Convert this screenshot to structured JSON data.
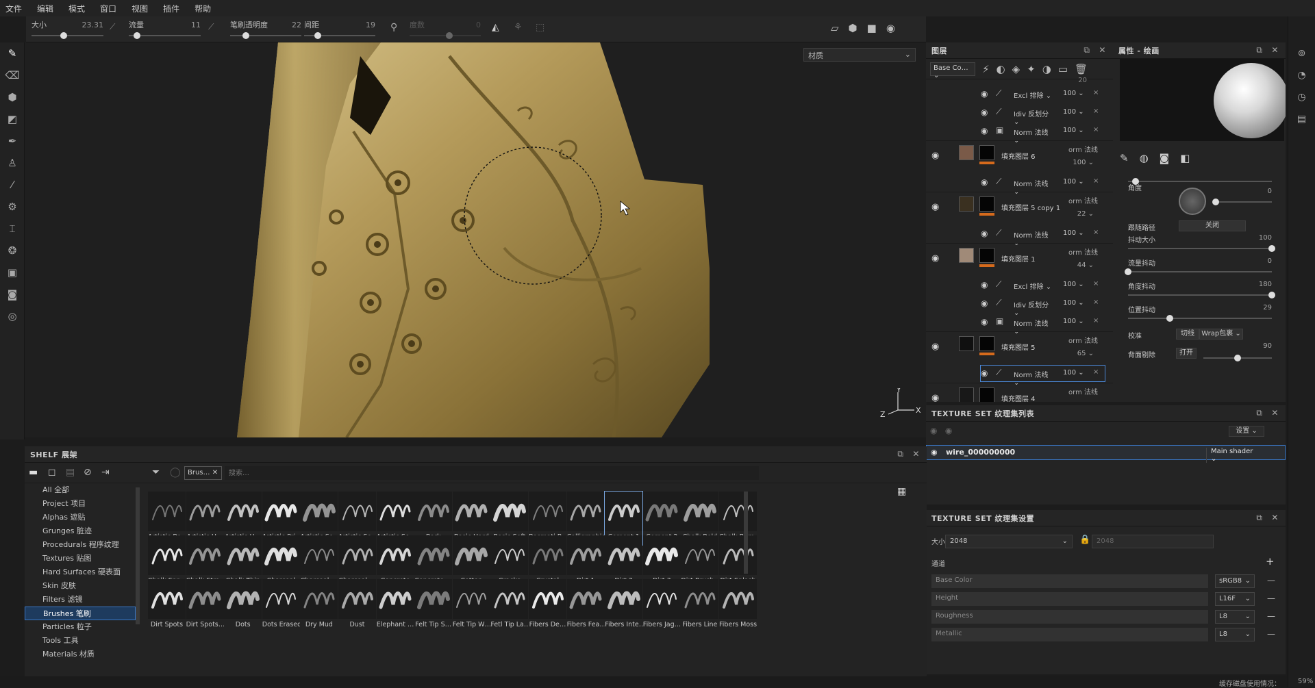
{
  "menu": [
    "文件",
    "编辑",
    "模式",
    "窗口",
    "视图",
    "插件",
    "帮助"
  ],
  "toolbar": {
    "size_label": "大小",
    "size_value": "23.31",
    "flow_label": "流量",
    "flow_value": "11",
    "opacity_label": "笔刷透明度",
    "opacity_value": "22",
    "spacing_label": "间距",
    "spacing_value": "19",
    "angle_label": "度数",
    "angle_value": "0"
  },
  "viewport": {
    "material_select": "材质"
  },
  "layers": {
    "title": "图层",
    "channel_select": "Base Co…",
    "top_value": "20",
    "rows": [
      {
        "kind": "sub",
        "mode": "Excl 排除",
        "op": "100"
      },
      {
        "kind": "sub",
        "mode": "Idiv 反划分",
        "op": "100"
      },
      {
        "kind": "sub",
        "mode": "Norm 法线",
        "op": "100",
        "mask": true
      },
      {
        "kind": "fill",
        "name": "填充图层 6",
        "mode": "orm 法线",
        "op": "100",
        "thumb": "#7a5a48"
      },
      {
        "kind": "sub",
        "mode": "Norm 法线",
        "op": "100"
      },
      {
        "kind": "fill",
        "name": "填充图层 5 copy 1",
        "mode": "orm 法线",
        "op": "22",
        "thumb": "#3a3020"
      },
      {
        "kind": "sub",
        "mode": "Norm 法线",
        "op": "100"
      },
      {
        "kind": "fill",
        "name": "填充图层 1",
        "mode": "orm 法线",
        "op": "44",
        "thumb": "#a08a78"
      },
      {
        "kind": "sub",
        "mode": "Excl 排除",
        "op": "100"
      },
      {
        "kind": "sub",
        "mode": "Idiv 反划分",
        "op": "100"
      },
      {
        "kind": "sub",
        "mode": "Norm 法线",
        "op": "100",
        "mask": true
      },
      {
        "kind": "fill",
        "name": "填充图层 5",
        "mode": "orm 法线",
        "op": "65",
        "thumb": "#101010"
      },
      {
        "kind": "sub",
        "mode": "Norm 法线",
        "op": "100",
        "selected": true
      },
      {
        "kind": "fill",
        "name": "填充图层 4",
        "mode": "orm 法线",
        "op": "100",
        "thumb": "#181818"
      }
    ]
  },
  "properties": {
    "title": "属性 - 绘画",
    "angle_label": "角度",
    "angle_value": "0",
    "angle_level": 0.0,
    "follow_path_label": "跟随路径",
    "follow_path_value": "关闭",
    "size_jitter_label": "抖动大小",
    "size_jitter_value": "100",
    "size_jitter_level": 1.0,
    "flow_jitter_label": "流量抖动",
    "flow_jitter_value": "0",
    "flow_jitter_level": 0.0,
    "angle_jitter_label": "角度抖动",
    "angle_jitter_value": "180",
    "angle_jitter_level": 1.0,
    "pos_jitter_label": "位置抖动",
    "pos_jitter_value": "29",
    "pos_jitter_level": 0.29,
    "alignment_label": "校准",
    "alignment_btn": "切线",
    "alignment_value": "Wrap包裹",
    "backface_label": "背面剔除",
    "backface_btn": "打开",
    "backface_value": "90",
    "backface_level": 0.5
  },
  "texture_set_list": {
    "title": "TEXTURE SET 纹理集列表",
    "settings_btn": "设置",
    "item_name": "wire_000000000",
    "item_shader": "Main shader"
  },
  "texture_set_settings": {
    "title": "TEXTURE SET 纹理集设置",
    "size_label": "大小",
    "size_value": "2048",
    "size_value2": "2048",
    "channels_label": "通道",
    "channels": [
      {
        "name": "Base Color",
        "format": "sRGB8"
      },
      {
        "name": "Height",
        "format": "L16F"
      },
      {
        "name": "Roughness",
        "format": "L8"
      },
      {
        "name": "Metallic",
        "format": "L8"
      }
    ]
  },
  "shelf": {
    "title": "SHELF 展架",
    "filter_tag": "Brus…",
    "search_placeholder": "搜索…",
    "categories": [
      "All 全部",
      "Project 项目",
      "Alphas 遮贴",
      "Grunges 脏迹",
      "Procedurals 程序纹理",
      "Textures 贴图",
      "Hard Surfaces 硬表面",
      "Skin 皮肤",
      "Filters 滤镜",
      "Brushes 笔刷",
      "Particles 粒子",
      "Tools 工具",
      "Materials 材质"
    ],
    "active_category": "Brushes 笔刷",
    "brushes": [
      "Artistic Br…",
      "Artistic H…",
      "Artistic H…",
      "Artistic Pri…",
      "Artistic So…",
      "Artistic So…",
      "Artistic So…",
      "Bark",
      "Basic Hard",
      "Basic Soft",
      "Basmati B…",
      "Calligraphic",
      "Cement 1",
      "Cement 2",
      "Chalk Bold",
      "Chalk Bum…",
      "Chalk Spr…",
      "Chalk Stro…",
      "Chalk Thin",
      "Charcoal",
      "Charcoal …",
      "Charcoal …",
      "Concrete",
      "Concrete …",
      "Cotton",
      "Cracks",
      "Crystal",
      "Dirt 1",
      "Dirt 2",
      "Dirt 3",
      "Dirt Brush…",
      "Dirt Splash",
      "Dirt Spots",
      "Dirt Spots…",
      "Dots",
      "Dots Erased",
      "Dry Mud",
      "Dust",
      "Elephant …",
      "Felt Tip S…",
      "Felt Tip W…",
      "Fetl Tip La…",
      "Fibers De…",
      "Fibers Fea…",
      "Fibers Inte…",
      "Fibers Jag…",
      "Fibers Line",
      "Fibers Moss"
    ],
    "selected_brush": "Cement 1"
  },
  "status": {
    "text": "缓存磁盘使用情况：",
    "percent": "59%"
  }
}
